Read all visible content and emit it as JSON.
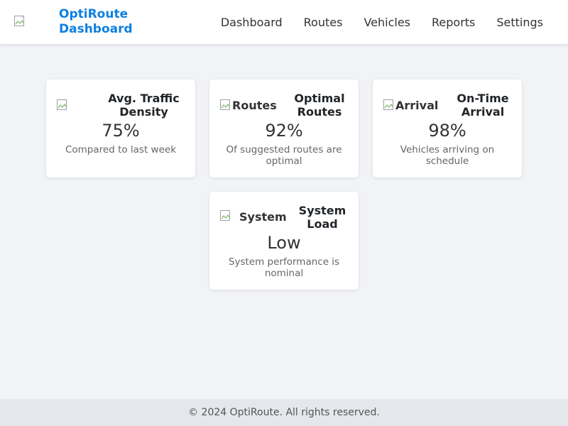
{
  "header": {
    "logo_alt": "",
    "brand": "OptiRoute Dashboard",
    "nav": [
      {
        "label": "Dashboard"
      },
      {
        "label": "Routes"
      },
      {
        "label": "Vehicles"
      },
      {
        "label": "Reports"
      },
      {
        "label": "Settings"
      }
    ]
  },
  "cards": [
    {
      "image_alt": "",
      "title": "Avg. Traffic Density",
      "value": "75%",
      "description": "Compared to last week"
    },
    {
      "image_alt": "Routes",
      "title": "Optimal Routes",
      "value": "92%",
      "description": "Of suggested routes are optimal"
    },
    {
      "image_alt": "Arrival",
      "title": "On-Time Arrival",
      "value": "98%",
      "description": "Vehicles arriving on schedule"
    },
    {
      "image_alt": "System",
      "title": "System Load",
      "value": "Low",
      "description": "System performance is nominal"
    }
  ],
  "footer": {
    "text": "© 2024 OptiRoute. All rights reserved."
  },
  "colors": {
    "brand": "#0d7fe0",
    "background": "#f1f3f6",
    "card": "#ffffff",
    "footer": "#e4e7eb"
  }
}
